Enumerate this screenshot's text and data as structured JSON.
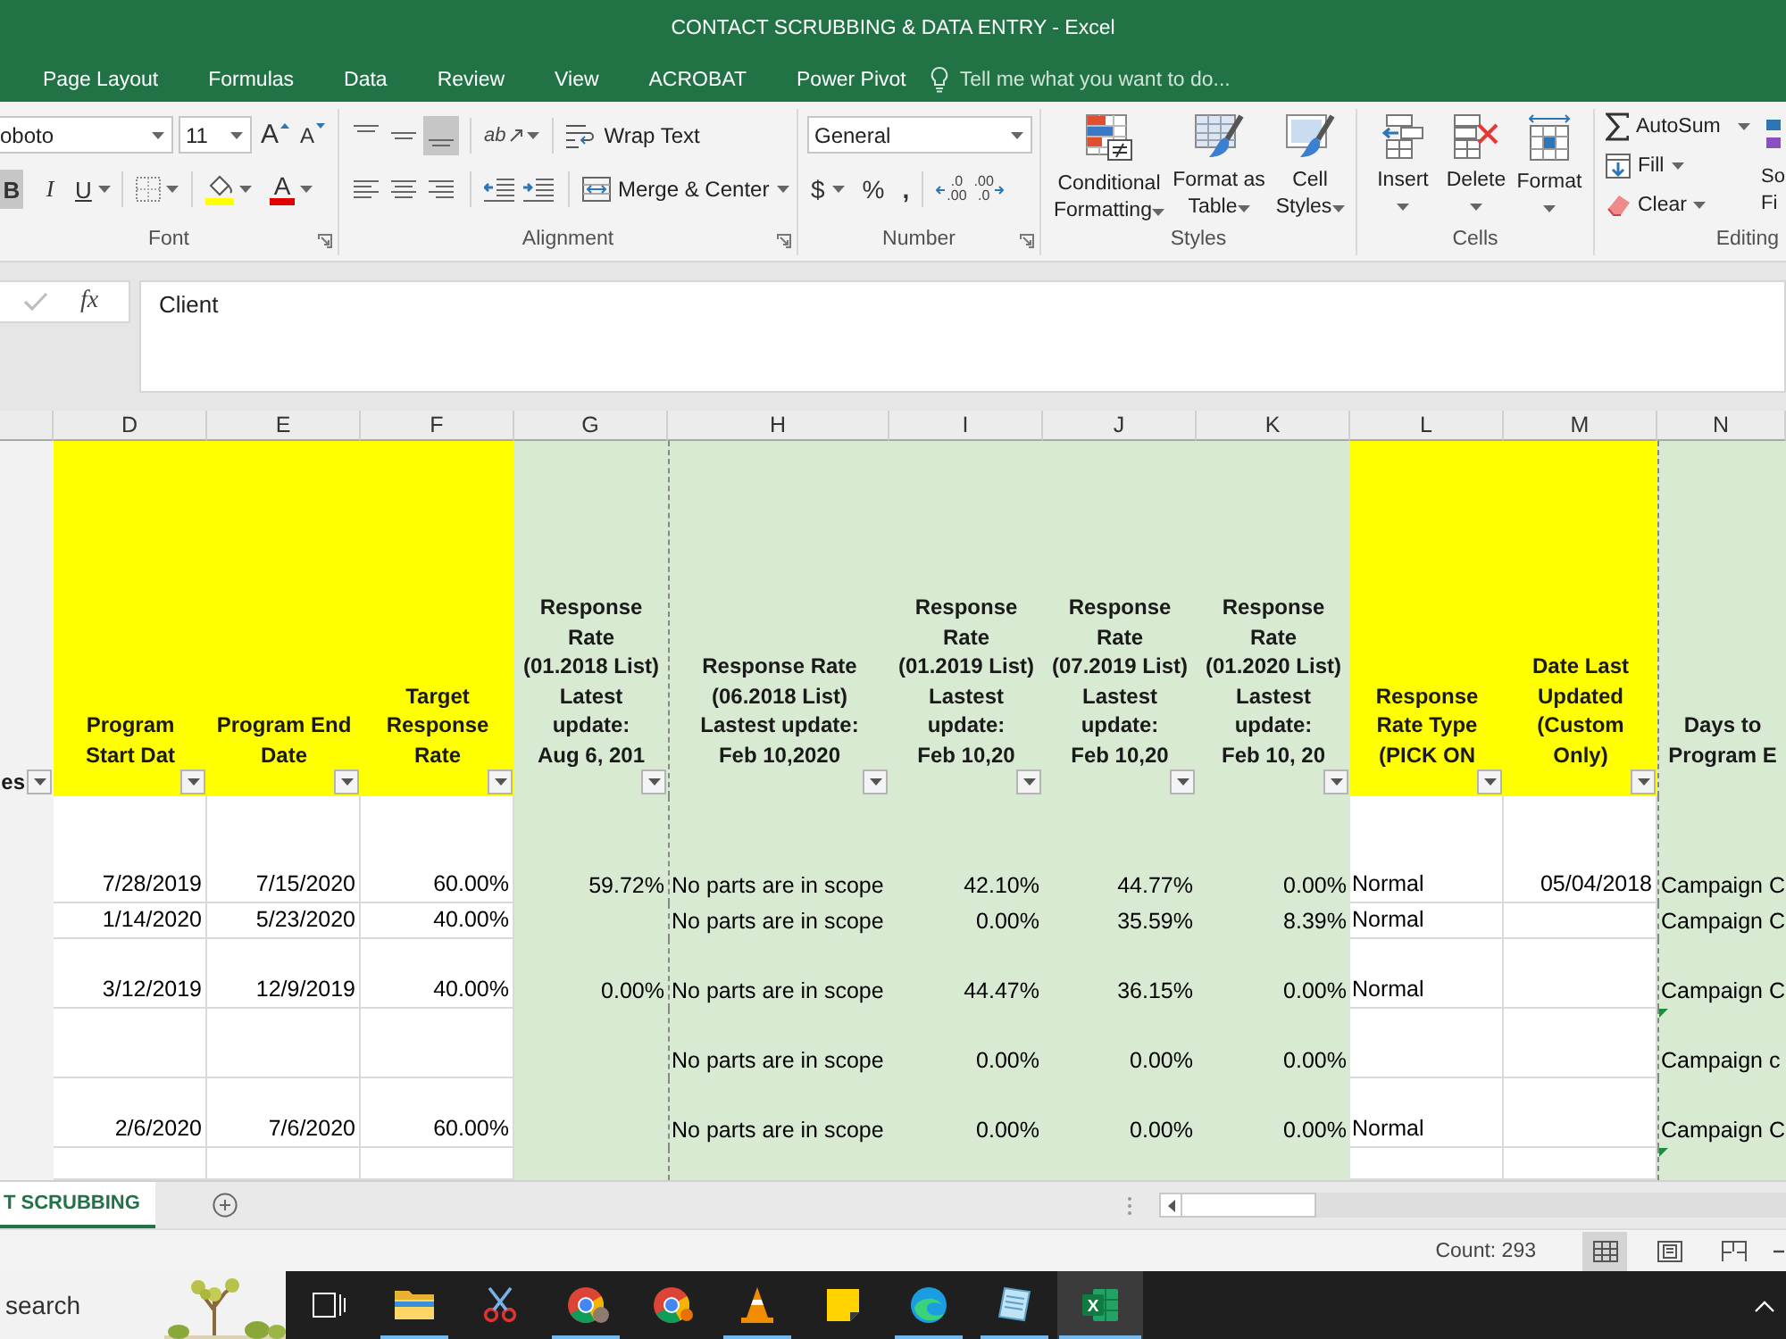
{
  "window": {
    "title": "CONTACT SCRUBBING & DATA ENTRY - Excel"
  },
  "menu_tabs": [
    {
      "label": "Page Layout",
      "selected": false
    },
    {
      "label": "Formulas",
      "selected": false
    },
    {
      "label": "Data",
      "selected": false
    },
    {
      "label": "Review",
      "selected": false
    },
    {
      "label": "View",
      "selected": false
    },
    {
      "label": "ACROBAT",
      "selected": false
    },
    {
      "label": "Power Pivot",
      "selected": false
    }
  ],
  "tell_me": {
    "placeholder": "Tell me what you want to do..."
  },
  "ribbon": {
    "font": {
      "font_name": "oboto",
      "font_size": "11",
      "grow": "A",
      "shrink": "A",
      "styles": [
        {
          "label": "B",
          "on": true
        },
        {
          "label": "I",
          "on": false
        },
        {
          "label": "U",
          "on": false
        }
      ],
      "font_color": "A",
      "label": "Font"
    },
    "alignment": {
      "vertical": [
        {
          "kind": "top",
          "selected": false
        },
        {
          "kind": "middle",
          "selected": false
        },
        {
          "kind": "bottom",
          "selected": true
        }
      ],
      "orientation": "ab",
      "wrap_text": "Wrap Text",
      "horizontal": [
        {
          "kind": "left",
          "selected": false
        },
        {
          "kind": "center",
          "selected": false
        },
        {
          "kind": "right",
          "selected": false
        }
      ],
      "merge": "Merge & Center",
      "label": "Alignment"
    },
    "number": {
      "format": "General",
      "currency": "$",
      "percent": "%",
      "comma": ",",
      "increase_decimal": ".0\n.00",
      "decrease_decimal": ".00\n.0",
      "label": "Number"
    },
    "styles": {
      "buttons": [
        {
          "kind": "conditional",
          "label": "Conditional\nFormatting"
        },
        {
          "kind": "table",
          "label": "Format as\nTable"
        },
        {
          "kind": "cell",
          "label": "Cell\nStyles"
        }
      ],
      "label": "Styles"
    },
    "cells": {
      "buttons": [
        {
          "kind": "insert",
          "label": "Insert"
        },
        {
          "kind": "delete",
          "label": "Delete"
        },
        {
          "kind": "format",
          "label": "Format"
        }
      ],
      "label": "Cells"
    },
    "editing": {
      "autosum": "AutoSum",
      "fill": "Fill",
      "clear": "Clear",
      "sort": "So\nFi",
      "label": "Editing"
    }
  },
  "formula_bar": {
    "confirm": {
      "disabled": true
    },
    "function": "fx",
    "value": "Client"
  },
  "sheet": {
    "columns": [
      {
        "kind": "plain",
        "header": "es",
        "filter": true,
        "page_break": false
      },
      {
        "letter": "D",
        "kind": "input",
        "header": "Program\nStart Dat",
        "filter": true,
        "page_break": false
      },
      {
        "letter": "E",
        "kind": "input",
        "header": "Program End\nDate",
        "filter": true,
        "page_break": false
      },
      {
        "letter": "F",
        "kind": "input",
        "header": "Target\nResponse\nRate",
        "filter": true,
        "page_break": false
      },
      {
        "letter": "G",
        "kind": "rate",
        "header": "Response\nRate\n(01.2018 List)\nLatest\nupdate:\nAug 6, 201",
        "filter": true,
        "page_break": false
      },
      {
        "letter": "H",
        "kind": "rate",
        "header": "Response Rate\n(06.2018 List)\nLastest update:\nFeb 10,2020",
        "filter": true,
        "page_break": true
      },
      {
        "letter": "I",
        "kind": "rate",
        "header": "Response\nRate\n(01.2019 List)\nLastest\nupdate:\nFeb 10,20",
        "filter": true,
        "page_break": false
      },
      {
        "letter": "J",
        "kind": "rate",
        "header": "Response\nRate\n(07.2019 List)\nLastest\nupdate:\nFeb 10,20",
        "filter": true,
        "page_break": false
      },
      {
        "letter": "K",
        "kind": "rate",
        "header": "Response\nRate\n(01.2020 List)\nLastest\nupdate:\nFeb 10, 20",
        "filter": true,
        "page_break": false
      },
      {
        "letter": "L",
        "kind": "input",
        "header": "Response\nRate Type\n(PICK ON",
        "filter": true,
        "page_break": false
      },
      {
        "letter": "M",
        "kind": "input",
        "header": "Date Last\nUpdated\n(Custom\nOnly)",
        "filter": true,
        "page_break": false
      },
      {
        "letter": "N",
        "kind": "rate",
        "header": "Days to\nProgram E",
        "filter": false,
        "page_break": true
      }
    ],
    "rows": [
      {
        "cells": [
          null,
          "7/28/2019",
          "7/15/2020",
          "60.00%",
          "59.72%",
          "No parts are in scope",
          "42.10%",
          "44.77%",
          "0.00%",
          "Normal",
          "05/04/2018",
          "Campaign C"
        ],
        "flagged": false
      },
      {
        "cells": [
          null,
          "1/14/2020",
          "5/23/2020",
          "40.00%",
          null,
          "No parts are in scope",
          "0.00%",
          "35.59%",
          "8.39%",
          "Normal",
          null,
          "Campaign C"
        ],
        "flagged": false
      },
      {
        "cells": [
          null,
          "3/12/2019",
          "12/9/2019",
          "40.00%",
          "0.00%",
          "No parts are in scope",
          "44.47%",
          "36.15%",
          "0.00%",
          "Normal",
          null,
          "Campaign C"
        ],
        "flagged": false
      },
      {
        "cells": [
          null,
          null,
          null,
          null,
          null,
          "No parts are in scope",
          "0.00%",
          "0.00%",
          "0.00%",
          null,
          null,
          "Campaign c"
        ],
        "flagged": true
      },
      {
        "cells": [
          null,
          "2/6/2020",
          "7/6/2020",
          "60.00%",
          null,
          "No parts are in scope",
          "0.00%",
          "0.00%",
          "0.00%",
          "Normal",
          null,
          "Campaign C"
        ],
        "flagged": false
      },
      {
        "cells": [
          null,
          null,
          null,
          null,
          null,
          null,
          null,
          null,
          null,
          null,
          null,
          null
        ],
        "flagged": true
      }
    ]
  },
  "sheet_tabs": [
    {
      "label": "T SCRUBBING",
      "selected": true
    }
  ],
  "status_bar": {
    "count": "Count: 293",
    "views": [
      {
        "kind": "normal",
        "selected": true
      },
      {
        "kind": "layout",
        "selected": false
      },
      {
        "kind": "breaks",
        "selected": false
      }
    ]
  },
  "taskbar": {
    "search": {
      "placeholder": "search"
    },
    "items": [
      {
        "kind": "taskview",
        "avatar": false,
        "badge": false,
        "running": false,
        "active": false
      },
      {
        "kind": "folder",
        "avatar": false,
        "badge": false,
        "running": true,
        "active": false
      },
      {
        "kind": "scissors",
        "avatar": false,
        "badge": false,
        "running": false,
        "active": false
      },
      {
        "kind": "browser",
        "avatar": true,
        "badge": false,
        "running": true,
        "active": false
      },
      {
        "kind": "browser",
        "avatar": false,
        "badge": true,
        "running": false,
        "active": false
      },
      {
        "kind": "cone",
        "avatar": false,
        "badge": false,
        "running": true,
        "active": false
      },
      {
        "kind": "note",
        "avatar": false,
        "badge": false,
        "running": false,
        "active": false
      },
      {
        "kind": "swirl",
        "avatar": false,
        "badge": false,
        "running": true,
        "active": false
      },
      {
        "kind": "notepad",
        "avatar": false,
        "badge": false,
        "running": true,
        "active": false
      },
      {
        "kind": "spreadsheet",
        "logo": "X",
        "avatar": false,
        "badge": false,
        "running": true,
        "active": true
      }
    ]
  }
}
